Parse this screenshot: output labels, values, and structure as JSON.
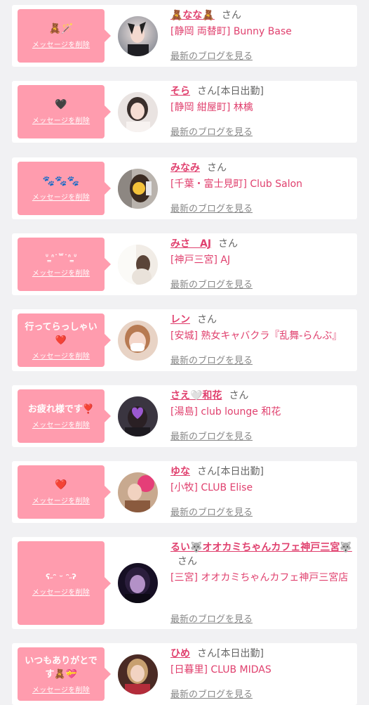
{
  "delete_label": "メッセージを削除",
  "blog_label": "最新のブログを見る",
  "san_label": "さん",
  "cards": [
    {
      "message": "🧸🪄",
      "name": "🧸なな🧸",
      "status": "",
      "shop": "[静岡 両替町] Bunny Base",
      "avatar_icon": "avatar-photo"
    },
    {
      "message": "🖤",
      "name": "そら",
      "status": "[本日出勤]",
      "shop": "[静岡 紺屋町] 林檎",
      "avatar_icon": "avatar-photo"
    },
    {
      "message": "🐾🐾🐾",
      "name": "みなみ",
      "status": "",
      "shop": "[千葉・富士見町] Club Salon",
      "avatar_icon": "avatar-photo"
    },
    {
      "message": "ᐡ ̳ᐢ˙꒳˙ᐢ ̳ᐡ",
      "name": "みさ　AJ",
      "status": "",
      "shop": "[神戸三宮] AJ",
      "avatar_icon": "avatar-photo"
    },
    {
      "message": "行ってらっしゃい❤️",
      "name": "レン",
      "status": "",
      "shop": "[安城] 熟女キャバクラ『乱舞-らんぶ』",
      "avatar_icon": "avatar-photo"
    },
    {
      "message": "お疲れ様です❣️",
      "name": "さえ🤍和花",
      "status": "",
      "shop": "[湯島] club lounge 和花",
      "avatar_icon": "avatar-photo"
    },
    {
      "message": "❤️",
      "name": "ゆな",
      "status": "[本日出勤]",
      "shop": "[小牧] CLUB Elise",
      "avatar_icon": "avatar-photo"
    },
    {
      "message": "ʕ˶ᵔ ᵕ ᵔ˶ʔ",
      "name": "るい🐺オオカミちゃんカフェ神戸三宮🐺",
      "status": "",
      "shop": "[三宮] オオカミちゃんカフェ神戸三宮店",
      "avatar_icon": "avatar-photo"
    },
    {
      "message": "いつもありがとです🧸💝",
      "name": "ひめ",
      "status": "[本日出勤]",
      "shop": "[日暮里] CLUB MIDAS",
      "avatar_icon": "avatar-photo"
    }
  ],
  "colors": {
    "bubble": "#ff9cae",
    "link": "#e0406e",
    "background": "#f1f1f3"
  }
}
